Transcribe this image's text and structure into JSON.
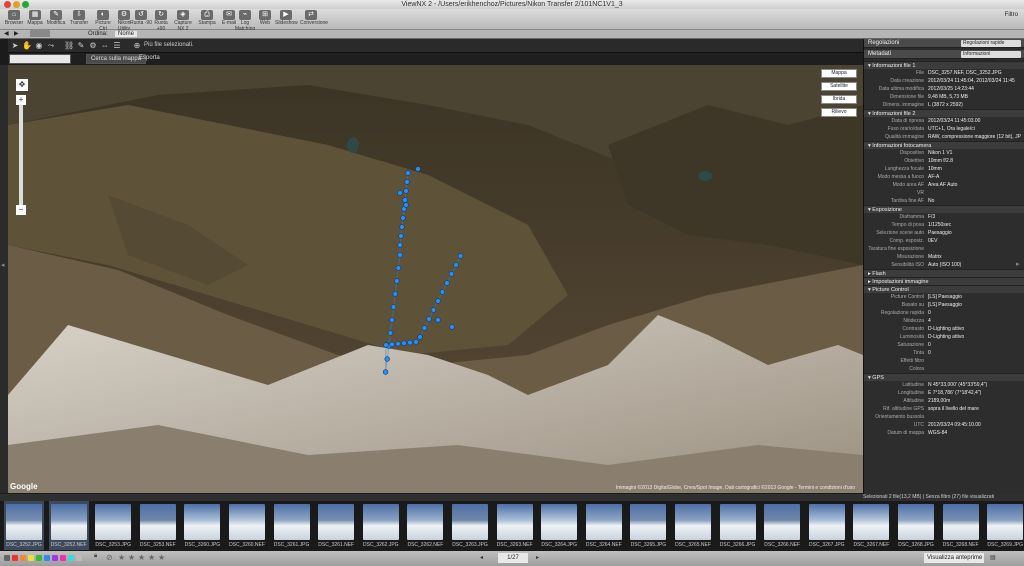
{
  "window": {
    "title": "ViewNX 2 - /Users/erikhenchoz/Pictures/Nikon Transfer 2/101NC1V1_3"
  },
  "toolbar": {
    "buttons": [
      "Browser",
      "Mappa",
      "Modifica",
      "Transfer",
      "Picture Ctrl",
      "Nikon Utility",
      "Ruota -90",
      "Ruota +90",
      "Capture NX 2",
      "Stampa",
      "E-mail",
      "Log Matching",
      "Web",
      "Slideshow",
      "Conversione"
    ],
    "filter_label": "Filtro"
  },
  "bar2": {
    "label": "Ordina:",
    "value": "Nome"
  },
  "maptools": {
    "selected_label": "Più file selezionati."
  },
  "mapsearch": {
    "button": "Cerca sulla mappa",
    "clear": "Esporta"
  },
  "map": {
    "types": [
      "Mappa",
      "Satellite",
      "Ibrida",
      "Rilievo"
    ],
    "credit": "Immagini ©2013 DigitalGlobe, Cnes/Spot Image, Dati cartografici ©2013 Google - Termini e condizioni d'uso",
    "google_logo": "Google"
  },
  "panel": {
    "header1": "Regolazioni",
    "header1_select": "Regolazioni rapide",
    "header2": "Metadati",
    "header2_select": "Informazioni file/fotocamera",
    "sections": [
      {
        "title": "Informazioni file 1",
        "rows": [
          [
            "File",
            "DSC_3257.NEF, DSC_3252.JPG"
          ],
          [
            "Data creazione",
            "2012/03/24 11:45:04, 2012/03/24 11:45"
          ],
          [
            "Data ultima modifica",
            "2012/03/25 14:23:44"
          ],
          [
            "Dimensione file",
            "9,48 MB, 5,73 MB"
          ],
          [
            "Dimens. immagine",
            "L (3872 x 2592)"
          ]
        ]
      },
      {
        "title": "Informazioni file 2",
        "rows": [
          [
            "Data di ripresa",
            "2012/03/24 11:45:03.00"
          ],
          [
            "Fuso orario/data",
            "UTC+1, Ora legale/ci"
          ],
          [
            "Qualità immagine",
            "RAW, compressione maggiore (12 bit), JPEG"
          ]
        ]
      },
      {
        "title": "Informazioni fotocamera",
        "rows": [
          [
            "Dispositivo",
            "Nikon 1 V1"
          ],
          [
            "Obiettivo",
            "10mm f/2.8"
          ],
          [
            "Lunghezza focale",
            "10mm"
          ],
          [
            "Modo messa a fuoco",
            "AF-A"
          ],
          [
            "Modo area AF",
            "Area AF Auto"
          ],
          [
            "VR",
            ""
          ],
          [
            "Tardiva fine AF",
            "No"
          ]
        ]
      },
      {
        "title": "Esposizione",
        "rows": [
          [
            "Diaframma",
            "F/3"
          ],
          [
            "Tempo di posa",
            "1/1250sec"
          ],
          [
            "Selezione scene auto",
            "Paesaggio"
          ],
          [
            "Comp. esposiz.",
            "0EV"
          ],
          [
            "Taratura fine esposizione",
            ""
          ],
          [
            "Misurazione",
            "Matrix"
          ],
          [
            "Sensibilità ISO",
            "Auto (ISO 100)"
          ]
        ]
      },
      {
        "title": "Flash",
        "rows": []
      },
      {
        "title": "Impostazioni immagine",
        "rows": []
      },
      {
        "title": "Picture Control",
        "rows": [
          [
            "Picture Control",
            "[LS] Paesaggio"
          ],
          [
            "Basato su",
            "[LS] Paesaggio"
          ],
          [
            "Regolazione rapida",
            "0"
          ],
          [
            "Nitidezza",
            "4"
          ],
          [
            "Contrasto",
            "D-Lighting attivo"
          ],
          [
            "Luminosità",
            "D-Lighting attivo"
          ],
          [
            "Saturazione",
            "0"
          ],
          [
            "Tinta",
            "0"
          ],
          [
            "Effetti filtro",
            ""
          ],
          [
            "Colora",
            ""
          ]
        ]
      },
      {
        "title": "GPS",
        "rows": [
          [
            "Latitudine",
            "N 45°33,000' (45°33'59,4\")"
          ],
          [
            "Longitudine",
            "E 7°18,786' (7°18'42,4\")"
          ],
          [
            "Altitudine",
            "2189,00m"
          ],
          [
            "Rif. altitudine GPS",
            "sopra il livello del mare"
          ],
          [
            "Orientamento bussola",
            ""
          ],
          [
            "UTC",
            "2012/03/24 09:45:10.00"
          ],
          [
            "Datum di mappa",
            "WGS-84"
          ]
        ]
      }
    ]
  },
  "status": {
    "text": "Selezionati 2 file(13,2 MB) | Senza filtro (27) file visualizzati"
  },
  "film": {
    "thumbs": [
      {
        "label": "DSC_3252.JPG",
        "selected": true
      },
      {
        "label": "DSC_3252.NEF",
        "selected": true
      },
      {
        "label": "DSC_3253.JPG",
        "selected": false
      },
      {
        "label": "DSC_3253.NEF",
        "selected": false
      },
      {
        "label": "DSC_3260.JPG",
        "selected": false
      },
      {
        "label": "DSC_3260.NEF",
        "selected": false
      },
      {
        "label": "DSC_3261.JPG",
        "selected": false
      },
      {
        "label": "DSC_3261.NEF",
        "selected": false
      },
      {
        "label": "DSC_3262.JPG",
        "selected": false
      },
      {
        "label": "DSC_3262.NEF",
        "selected": false
      },
      {
        "label": "DSC_3263.JPG",
        "selected": false
      },
      {
        "label": "DSC_3263.NEF",
        "selected": false
      },
      {
        "label": "DSC_3264.JPG",
        "selected": false
      },
      {
        "label": "DSC_3264.NEF",
        "selected": false
      },
      {
        "label": "DSC_3265.JPG",
        "selected": false
      },
      {
        "label": "DSC_3265.NEF",
        "selected": false
      },
      {
        "label": "DSC_3266.JPG",
        "selected": false
      },
      {
        "label": "DSC_3266.NEF",
        "selected": false
      },
      {
        "label": "DSC_3267.JPG",
        "selected": false
      },
      {
        "label": "DSC_3267.NEF",
        "selected": false
      },
      {
        "label": "DSC_3268.JPG",
        "selected": false
      },
      {
        "label": "DSC_3268.NEF",
        "selected": false
      },
      {
        "label": "DSC_3269.JPG",
        "selected": false
      }
    ]
  },
  "bottombar": {
    "page": "1/27",
    "view_select": "Visualizza anteprime"
  }
}
